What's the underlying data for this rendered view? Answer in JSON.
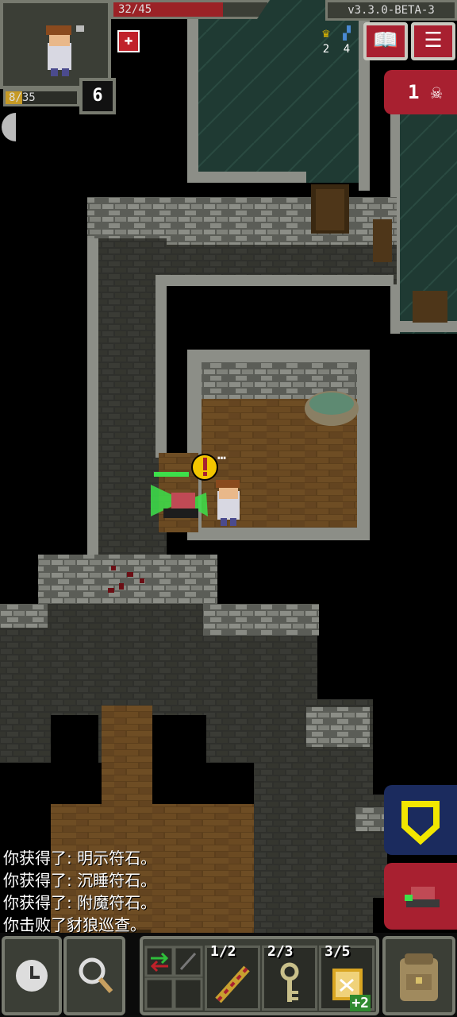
{
  "status": {
    "hp": "32/45",
    "hp_fraction": 0.71,
    "xp": "8/35",
    "xp_fraction": 0.23,
    "level": "6",
    "buff_icon": "red-cross-icon"
  },
  "version": "v3.3.0-BETA-3",
  "counters": {
    "gold_icon": "trophy-icon",
    "gold": "2",
    "depth_icon": "stairs-icon",
    "depth": "4"
  },
  "buttons": {
    "journal_icon": "open-book-icon",
    "menu_icon": "menu-lines-icon",
    "danger_count": "1",
    "danger_icon": "skull-icon",
    "guard_icon": "shield-outline-icon",
    "attack_icon": "enemy-crab-icon",
    "wait_icon": "clock-icon",
    "search_icon": "magnifier-icon",
    "backpack_icon": "backpack-icon"
  },
  "speech": "…",
  "log": [
    "你获得了: 明示符石。",
    "你获得了: 沉睡符石。",
    "你获得了: 附魔符石。",
    "你击败了豺狼巡查。"
  ],
  "quickslots": [
    {
      "label": "1/2",
      "icon": "wand-icon"
    },
    {
      "label": "2/3",
      "icon": "key-icon"
    },
    {
      "label": "3/5",
      "icon": "scroll-icon",
      "bonus": "+2"
    }
  ],
  "colors": {
    "hud_panel": "#3b3e36",
    "hud_border": "#777a6f",
    "danger_red": "#a82030",
    "guard_blue": "#1b2b5e",
    "hp_red": "#9b2226",
    "xp_gold": "#c79a25"
  }
}
